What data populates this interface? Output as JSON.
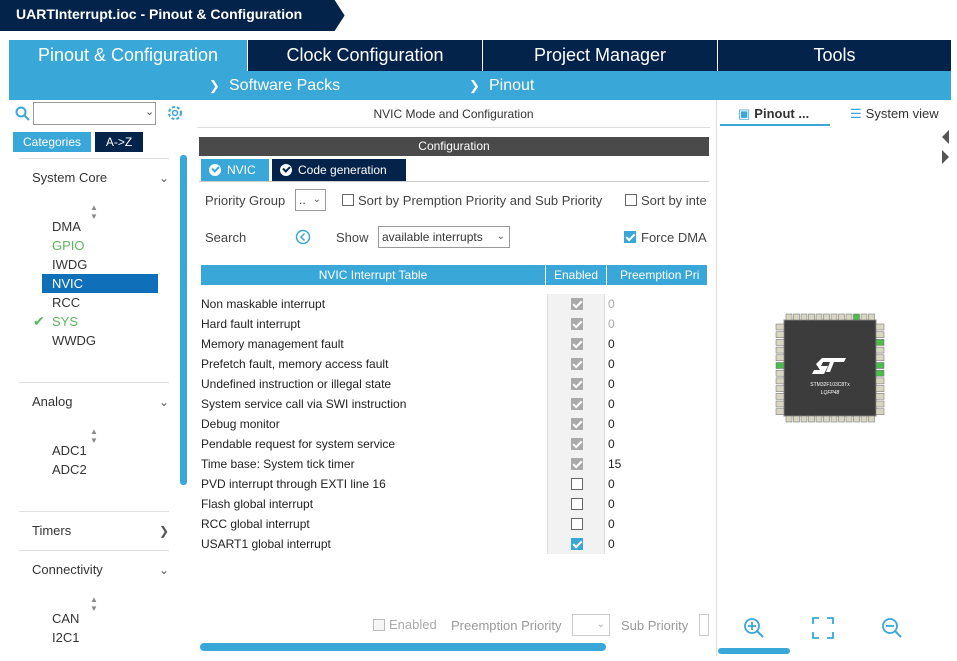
{
  "title": "UARTInterrupt.ioc - Pinout & Configuration",
  "main_tabs": [
    {
      "label": "Pinout & Configuration"
    },
    {
      "label": "Clock Configuration"
    },
    {
      "label": "Project Manager"
    },
    {
      "label": "Tools"
    }
  ],
  "sub_menus": [
    {
      "label": "Software Packs"
    },
    {
      "label": "Pinout"
    }
  ],
  "left_panel": {
    "search_value": "",
    "category_tabs": [
      {
        "label": "Categories"
      },
      {
        "label": "A->Z"
      }
    ],
    "sections": {
      "system_core": {
        "label": "System Core",
        "items": [
          "DMA",
          "GPIO",
          "IWDG",
          "NVIC",
          "RCC",
          "SYS",
          "WWDG"
        ],
        "selected": "NVIC"
      },
      "analog": {
        "label": "Analog",
        "items": [
          "ADC1",
          "ADC2"
        ]
      },
      "timers": {
        "label": "Timers"
      },
      "connectivity": {
        "label": "Connectivity",
        "items": [
          "CAN",
          "I2C1"
        ]
      }
    }
  },
  "middle_panel": {
    "mode_header": "NVIC Mode and Configuration",
    "config_header": "Configuration",
    "config_tabs": [
      {
        "label": "NVIC"
      },
      {
        "label": "Code generation"
      }
    ],
    "priority_group_label": "Priority Group",
    "priority_group_value": "..",
    "sort_premption_label": "Sort by Premption Priority and Sub Priority",
    "sort_interrupt_label": "Sort by inte",
    "search_label": "Search",
    "show_label": "Show",
    "show_value": "available interrupts",
    "force_dma_label": "Force DMA",
    "table": {
      "headers": [
        "NVIC Interrupt Table",
        "Enabled",
        "Preemption Pri"
      ],
      "rows": [
        {
          "name": "Non maskable interrupt",
          "enabled": true,
          "locked": true,
          "priority": "0"
        },
        {
          "name": "Hard fault interrupt",
          "enabled": true,
          "locked": true,
          "priority": "0"
        },
        {
          "name": "Memory management fault",
          "enabled": true,
          "locked": true,
          "priority": "0"
        },
        {
          "name": "Prefetch fault, memory access fault",
          "enabled": true,
          "locked": true,
          "priority": "0"
        },
        {
          "name": "Undefined instruction or illegal state",
          "enabled": true,
          "locked": true,
          "priority": "0"
        },
        {
          "name": "System service call via SWI instruction",
          "enabled": true,
          "locked": true,
          "priority": "0"
        },
        {
          "name": "Debug monitor",
          "enabled": true,
          "locked": true,
          "priority": "0"
        },
        {
          "name": "Pendable request for system service",
          "enabled": true,
          "locked": true,
          "priority": "0"
        },
        {
          "name": "Time base: System tick timer",
          "enabled": true,
          "locked": true,
          "priority": "15"
        },
        {
          "name": "PVD interrupt through EXTI line 16",
          "enabled": false,
          "locked": false,
          "priority": "0"
        },
        {
          "name": "Flash global interrupt",
          "enabled": false,
          "locked": false,
          "priority": "0"
        },
        {
          "name": "RCC global interrupt",
          "enabled": false,
          "locked": false,
          "priority": "0"
        },
        {
          "name": "USART1 global interrupt",
          "enabled": true,
          "locked": false,
          "priority": "0"
        }
      ]
    },
    "bottom_enabled_label": "Enabled",
    "bottom_preemption_label": "Preemption Priority",
    "bottom_sub_label": "Sub Priority"
  },
  "right_panel": {
    "tabs": [
      {
        "label": "Pinout ..."
      },
      {
        "label": "System view"
      }
    ],
    "chip_name": "STM32F103C8Tx",
    "chip_package": "LQFP48",
    "accent_color": "#3aa7d9",
    "nav_color": "#03234b"
  }
}
